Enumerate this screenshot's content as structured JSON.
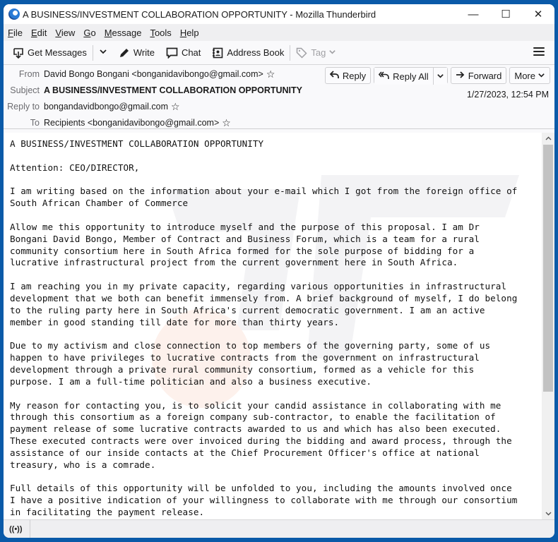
{
  "window": {
    "title": "A BUSINESS/INVESTMENT COLLABORATION OPPORTUNITY - Mozilla Thunderbird",
    "controls": {
      "minimize": "—",
      "maximize": "☐",
      "close": "✕"
    }
  },
  "menubar": {
    "items": [
      {
        "key": "F",
        "rest": "ile"
      },
      {
        "key": "E",
        "rest": "dit"
      },
      {
        "key": "V",
        "rest": "iew"
      },
      {
        "key": "G",
        "rest": "o"
      },
      {
        "key": "M",
        "rest": "essage"
      },
      {
        "key": "T",
        "rest": "ools"
      },
      {
        "key": "H",
        "rest": "elp"
      }
    ]
  },
  "toolbar": {
    "get_messages": "Get Messages",
    "write": "Write",
    "chat": "Chat",
    "address_book": "Address Book",
    "tag": "Tag"
  },
  "header": {
    "from_label": "From",
    "from_value": "David Bongo Bongani <bonganidavibongo@gmail.com>",
    "subject_label": "Subject",
    "subject_value": "A BUSINESS/INVESTMENT COLLABORATION OPPORTUNITY",
    "reply_to_label": "Reply to",
    "reply_to_value": "bongandavidbongo@gmail.com",
    "to_label": "To",
    "to_value": "Recipients <bonganidavibongo@gmail.com>",
    "date": "1/27/2023, 12:54 PM",
    "actions": {
      "reply": "Reply",
      "reply_all": "Reply All",
      "forward": "Forward",
      "more": "More"
    }
  },
  "body": {
    "lines": [
      "A BUSINESS/INVESTMENT COLLABORATION OPPORTUNITY",
      "",
      "Attention: CEO/DIRECTOR,",
      "",
      "I am writing based on the information about your e-mail which I got from the foreign office of",
      "South African Chamber of Commerce",
      "",
      "Allow me this opportunity to introduce myself and the purpose of this proposal. I am Dr",
      "Bongani David Bongo, Member of Contract and Business Forum, which is a team for a rural",
      "community consortium here in South Africa formed for the sole purpose of bidding for a",
      "lucrative infrastructural project from the current government here in South Africa.",
      "",
      "I am reaching you in my private capacity, regarding various opportunities in infrastructural",
      "development that we both can benefit immensely from. A brief background of myself, I do belong",
      "to the ruling party here in South Africa's current democratic government. I am an active",
      "member in good standing till date for more than thirty years.",
      "",
      "Due to my activism and close connection to top members of the governing party, some of us",
      "happen to have privileges to lucrative contracts from the government on infrastructural",
      "development through a private rural community consortium, formed as a vehicle for this",
      "purpose. I am a full-time politician and also a business executive.",
      "",
      "My reason for contacting you, is to solicit your candid assistance in collaborating with me",
      "through this consortium as a foreign company sub-contractor, to enable the facilitation of",
      "payment release of some lucrative contracts awarded to us and which has also been executed.",
      "These executed contracts were over invoiced during the bidding and award process, through the",
      "assistance of our inside contacts at the Chief Procurement Officer's office at national",
      "treasury, who is a comrade.",
      "",
      "Full details of this opportunity will be unfolded to you, including the amounts involved once",
      "I have a positive indication of your willingness to collaborate with me through our consortium",
      "in facilitating the payment release."
    ]
  },
  "statusbar": {
    "icon": "((•))"
  }
}
